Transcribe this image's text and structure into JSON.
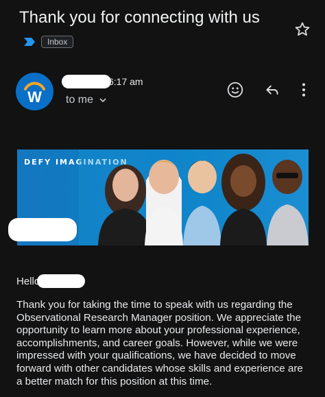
{
  "email": {
    "subject": "Thank you for connecting with us",
    "label": "Inbox",
    "time": "6:17 am",
    "recipient": "to me",
    "greeting": "Hello",
    "body": "Thank you for taking the time to speak with us regarding the Observational Research Manager position. We appreciate the opportunity to learn more about your professional experience, accomplishments, and career goals. However, while we were impressed with your qualifications, we have decided to move forward with other candidates whose skills and experience are a better match for this position at this time."
  },
  "sender": {
    "avatar_letter": "W",
    "avatar_color": "#0a6fc7"
  },
  "banner": {
    "tagline": "DEFY IMAGINATION"
  },
  "icons": {
    "star": "star-outline-icon",
    "important": "important-marker-icon",
    "react": "emoji-icon",
    "reply": "reply-icon",
    "more": "more-vert-icon",
    "expand": "chevron-down-icon"
  },
  "colors": {
    "background": "#121212",
    "banner": "#1478c0",
    "important": "#2196f3"
  }
}
